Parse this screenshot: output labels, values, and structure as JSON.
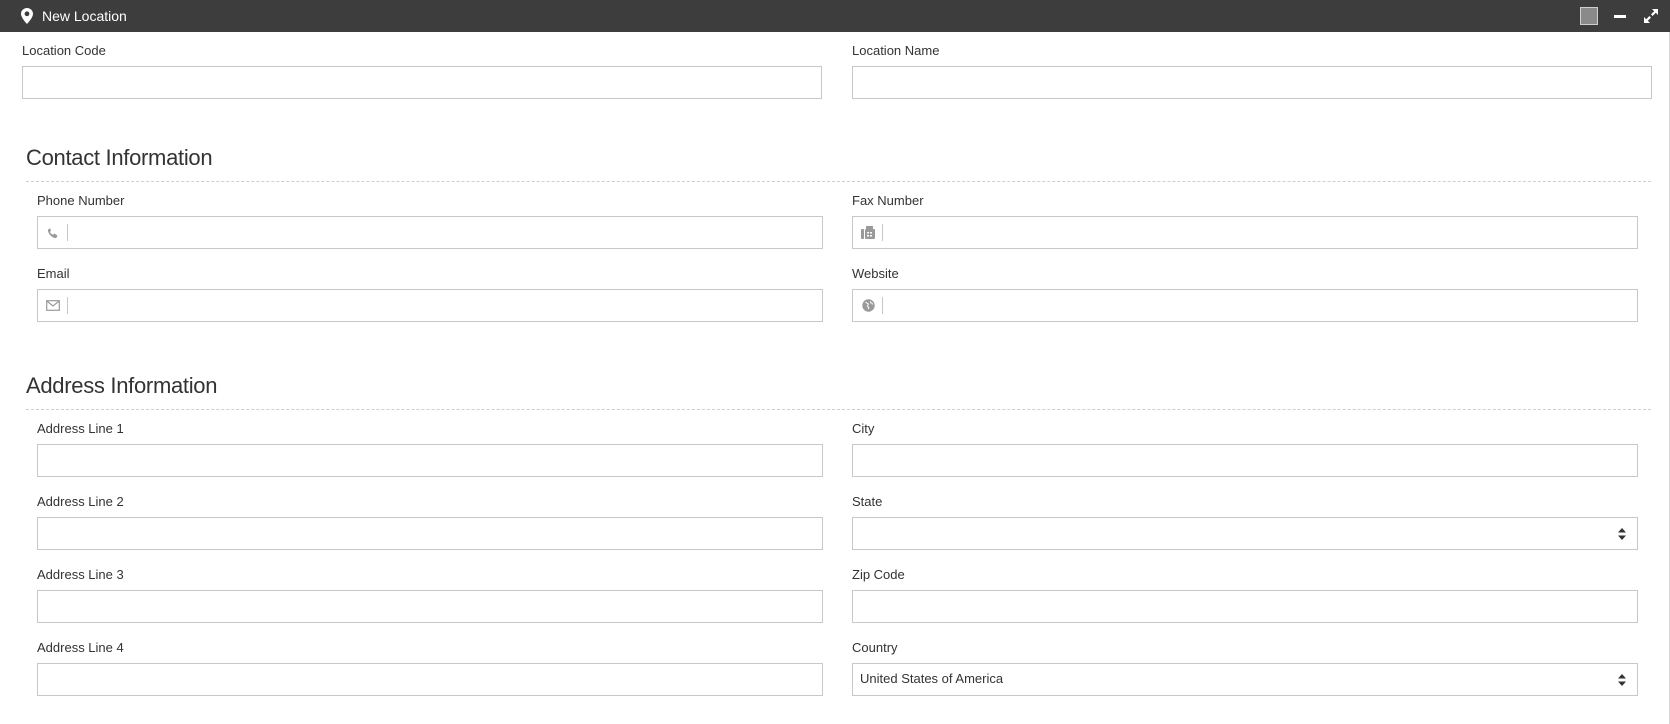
{
  "window": {
    "title": "New Location",
    "icons": {
      "title": "map-marker-icon",
      "restore": "square-icon",
      "minimize": "minimize-icon",
      "maximize": "expand-icon"
    }
  },
  "form": {
    "location_code_label": "Location Code",
    "location_code_value": "",
    "location_name_label": "Location Name",
    "location_name_value": ""
  },
  "contact": {
    "heading": "Contact Information",
    "phone_label": "Phone Number",
    "phone_value": "",
    "phone_icon": "phone-icon",
    "fax_label": "Fax Number",
    "fax_value": "",
    "fax_icon": "fax-icon",
    "email_label": "Email",
    "email_value": "",
    "email_icon": "envelope-icon",
    "website_label": "Website",
    "website_value": "",
    "website_icon": "globe-icon"
  },
  "address": {
    "heading": "Address Information",
    "line1_label": "Address Line 1",
    "line1_value": "",
    "line2_label": "Address Line 2",
    "line2_value": "",
    "line3_label": "Address Line 3",
    "line3_value": "",
    "line4_label": "Address Line 4",
    "line4_value": "",
    "city_label": "City",
    "city_value": "",
    "state_label": "State",
    "state_value": "",
    "zip_label": "Zip Code",
    "zip_value": "",
    "country_label": "Country",
    "country_value": "United States of America"
  },
  "colors": {
    "titlebar": "#3d3d3d",
    "border": "#c8c8c8",
    "divider": "#cfcfcf"
  }
}
